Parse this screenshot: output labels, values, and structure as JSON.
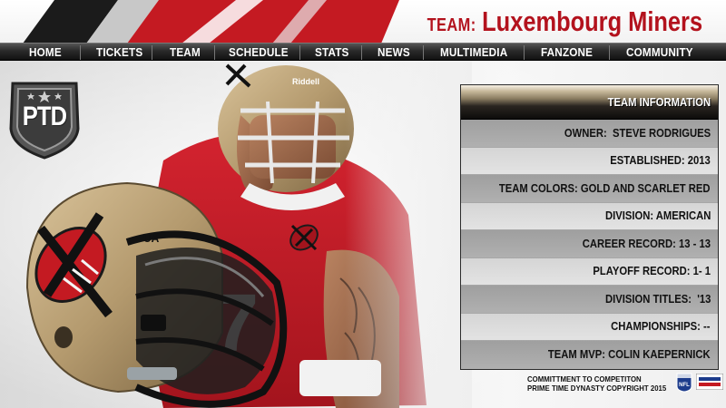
{
  "header": {
    "team_prefix": "TEAM:",
    "team_name": "Luxembourg Miners",
    "accent_color": "#b3121d"
  },
  "nav": {
    "items": [
      {
        "label": "HOME"
      },
      {
        "label": "TICKETS"
      },
      {
        "label": "TEAM"
      },
      {
        "label": "SCHEDULE"
      },
      {
        "label": "STATS"
      },
      {
        "label": "NEWS"
      },
      {
        "label": "MULTIMEDIA"
      },
      {
        "label": "FANZONE"
      },
      {
        "label": "COMMUNITY"
      }
    ]
  },
  "logo": {
    "text": "PTD",
    "icon": "shield-icon"
  },
  "team_info": {
    "heading": "TEAM INFORMATION",
    "rows": [
      {
        "text": "OWNER:  STEVE RODRIGUES"
      },
      {
        "text": "ESTABLISHED: 2013"
      },
      {
        "text": "TEAM COLORS: GOLD AND SCARLET RED"
      },
      {
        "text": "DIVISION: AMERICAN"
      },
      {
        "text": "CAREER RECORD: 13 - 13"
      },
      {
        "text": "PLAYOFF RECORD: 1- 1"
      },
      {
        "text": "DIVISION TITLES:  '13"
      },
      {
        "text": "CHAMPIONSHIPS: --"
      },
      {
        "text": "TEAM MVP: COLIN KAEPERNICK"
      }
    ]
  },
  "footer": {
    "line1": "COMMITTMENT TO COMPETITON",
    "line2": "PRIME TIME DYNASTY COPYRIGHT 2015",
    "nfl_logo_text": "NFL"
  },
  "colors": {
    "helmet_gold": "#b49a6e",
    "jersey_red": "#c8202b",
    "panel_dark": "#1a1714"
  }
}
